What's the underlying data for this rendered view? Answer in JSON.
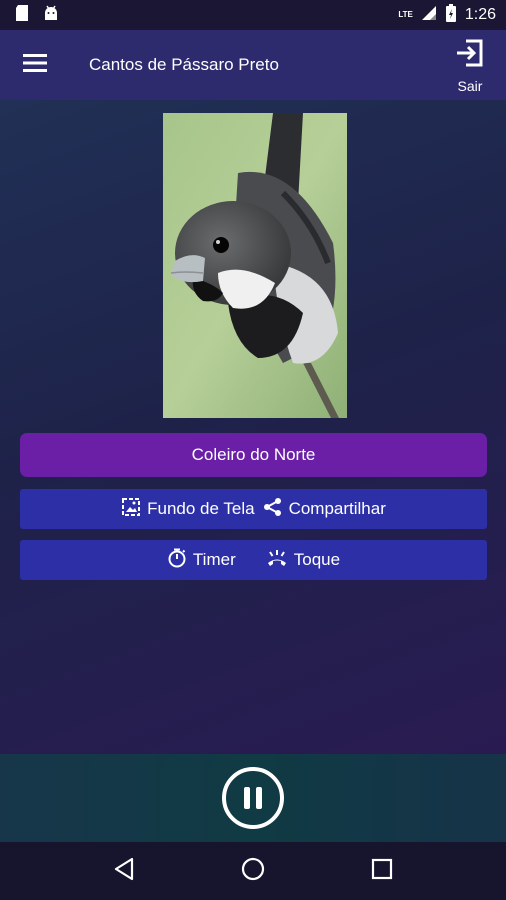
{
  "status": {
    "time": "1:26",
    "network": "LTE",
    "icons": [
      "sd-card-icon",
      "android-icon",
      "signal-icon",
      "battery-icon"
    ]
  },
  "app_bar": {
    "title": "Cantos de Pássaro Preto",
    "exit_label": "Sair"
  },
  "main": {
    "image_icon": "bird-photo",
    "primary_button": "Coleiro do Norte",
    "row1": {
      "wallpaper_label": "Fundo de Tela",
      "share_label": "Compartilhar"
    },
    "row2": {
      "timer_label": "Timer",
      "ringtone_label": "Toque"
    }
  },
  "player": {
    "state": "playing",
    "control": "pause-icon"
  },
  "nav": [
    "back-icon",
    "home-icon",
    "recents-icon"
  ],
  "colors": {
    "app_bar": "#2d2b6e",
    "primary_button": "#6a1fa6",
    "row_button": "#2d2fa6",
    "player_bar": "#103a44"
  }
}
